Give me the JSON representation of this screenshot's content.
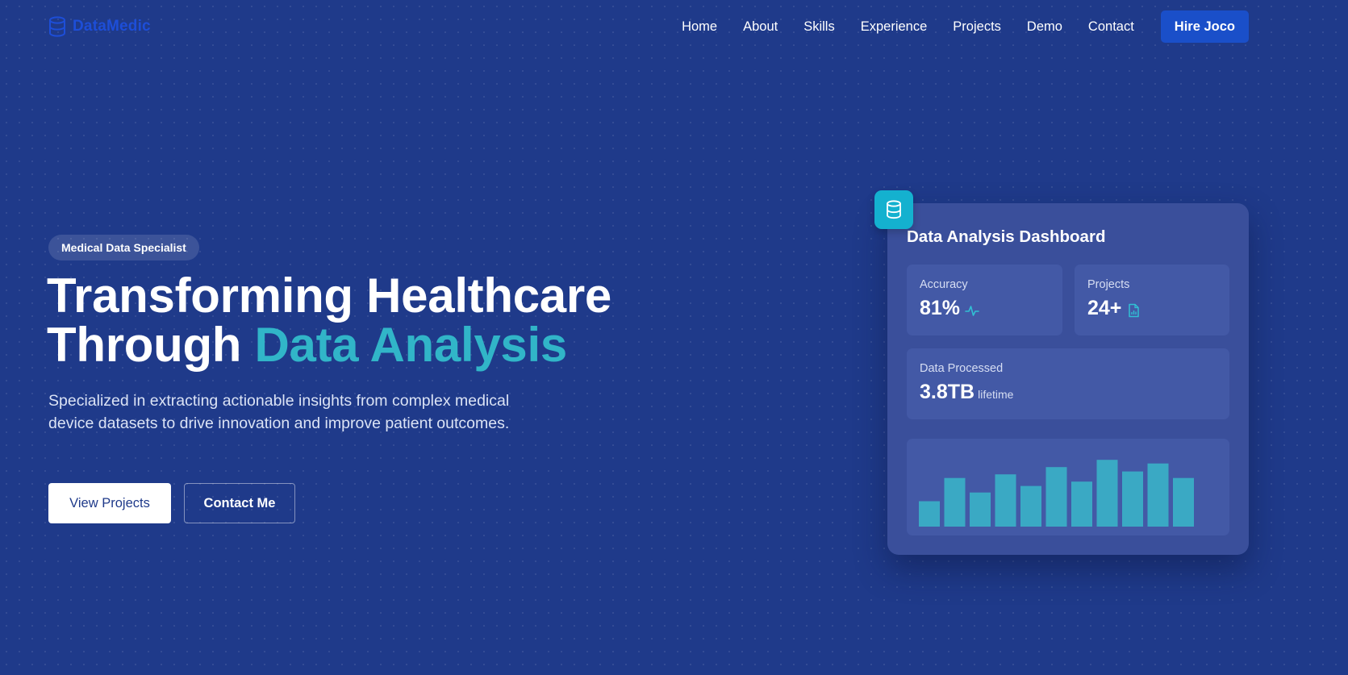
{
  "nav": {
    "logo_text": "DataMedic",
    "logo_icon": "database-icon",
    "links": [
      "Home",
      "About",
      "Skills",
      "Experience",
      "Projects",
      "Demo",
      "Contact"
    ],
    "cta_label": "Hire Joco"
  },
  "hero": {
    "badge": "Medical Data Specialist",
    "headline_line1": "Transforming Healthcare",
    "headline_line2_plain": "Through ",
    "headline_line2_accent": "Data Analysis",
    "subtitle": "Specialized in extracting actionable insights from complex medical device datasets to drive innovation and improve patient outcomes.",
    "primary_button": "View Projects",
    "secondary_button": "Contact Me"
  },
  "dashboard": {
    "badge_icon": "database-icon",
    "title": "Data Analysis Dashboard",
    "stats": {
      "accuracy": {
        "label": "Accuracy",
        "value": "81%",
        "icon": "activity-icon"
      },
      "projects": {
        "label": "Projects",
        "value": "24+",
        "icon": "file-chart-icon"
      },
      "data": {
        "label": "Data Processed",
        "value": "3.8TB",
        "suffix": "lifetime"
      }
    }
  },
  "colors": {
    "background": "#1f3a8a",
    "accent_teal": "#31b5c8",
    "brand_blue": "#1d4ed8",
    "button_blue": "#1a4fc9",
    "card": "#3a4f9b",
    "card_inner": "#4359a6",
    "bar": "#3aa9c4"
  },
  "chart_data": {
    "type": "bar",
    "values": [
      35,
      67,
      47,
      72,
      56,
      82,
      62,
      92,
      76,
      87,
      67
    ],
    "ylim": [
      0,
      100
    ],
    "xlabel": "",
    "ylabel": ""
  }
}
